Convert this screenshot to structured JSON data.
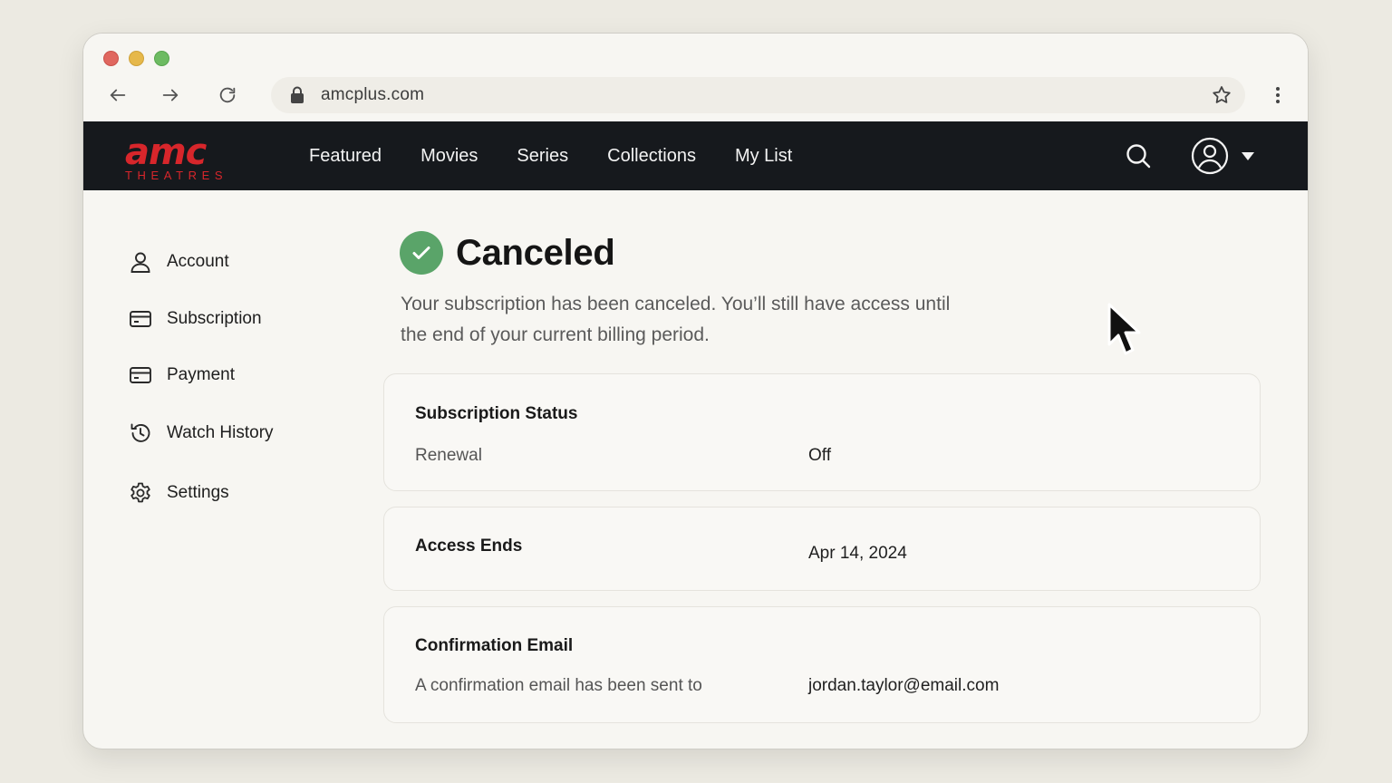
{
  "browser": {
    "url": "amcplus.com"
  },
  "brand": {
    "logo_main": "amc",
    "logo_sub": "THEATRES",
    "color": "#d7262b"
  },
  "nav": {
    "items": [
      {
        "label": "Featured"
      },
      {
        "label": "Movies"
      },
      {
        "label": "Series"
      },
      {
        "label": "Collections"
      },
      {
        "label": "My List"
      }
    ]
  },
  "sidebar": {
    "items": [
      {
        "label": "Account",
        "icon": "user-icon"
      },
      {
        "label": "Subscription",
        "icon": "card-icon"
      },
      {
        "label": "Payment",
        "icon": "card-icon"
      },
      {
        "label": "Watch History",
        "icon": "history-icon"
      },
      {
        "label": "Settings",
        "icon": "gear-icon"
      }
    ]
  },
  "main": {
    "title": "Canceled",
    "status_color": "#5aa469",
    "description": "Your subscription has been canceled. You’ll still have access until the end of your current billing period.",
    "cards": {
      "status": {
        "title": "Subscription Status",
        "key": "Renewal",
        "value": "Off"
      },
      "access": {
        "title": "Access Ends",
        "value": "Apr 14, 2024"
      },
      "email": {
        "title": "Confirmation Email",
        "key": "A confirmation email has been sent to",
        "value": "jordan.taylor@email.com"
      }
    }
  }
}
